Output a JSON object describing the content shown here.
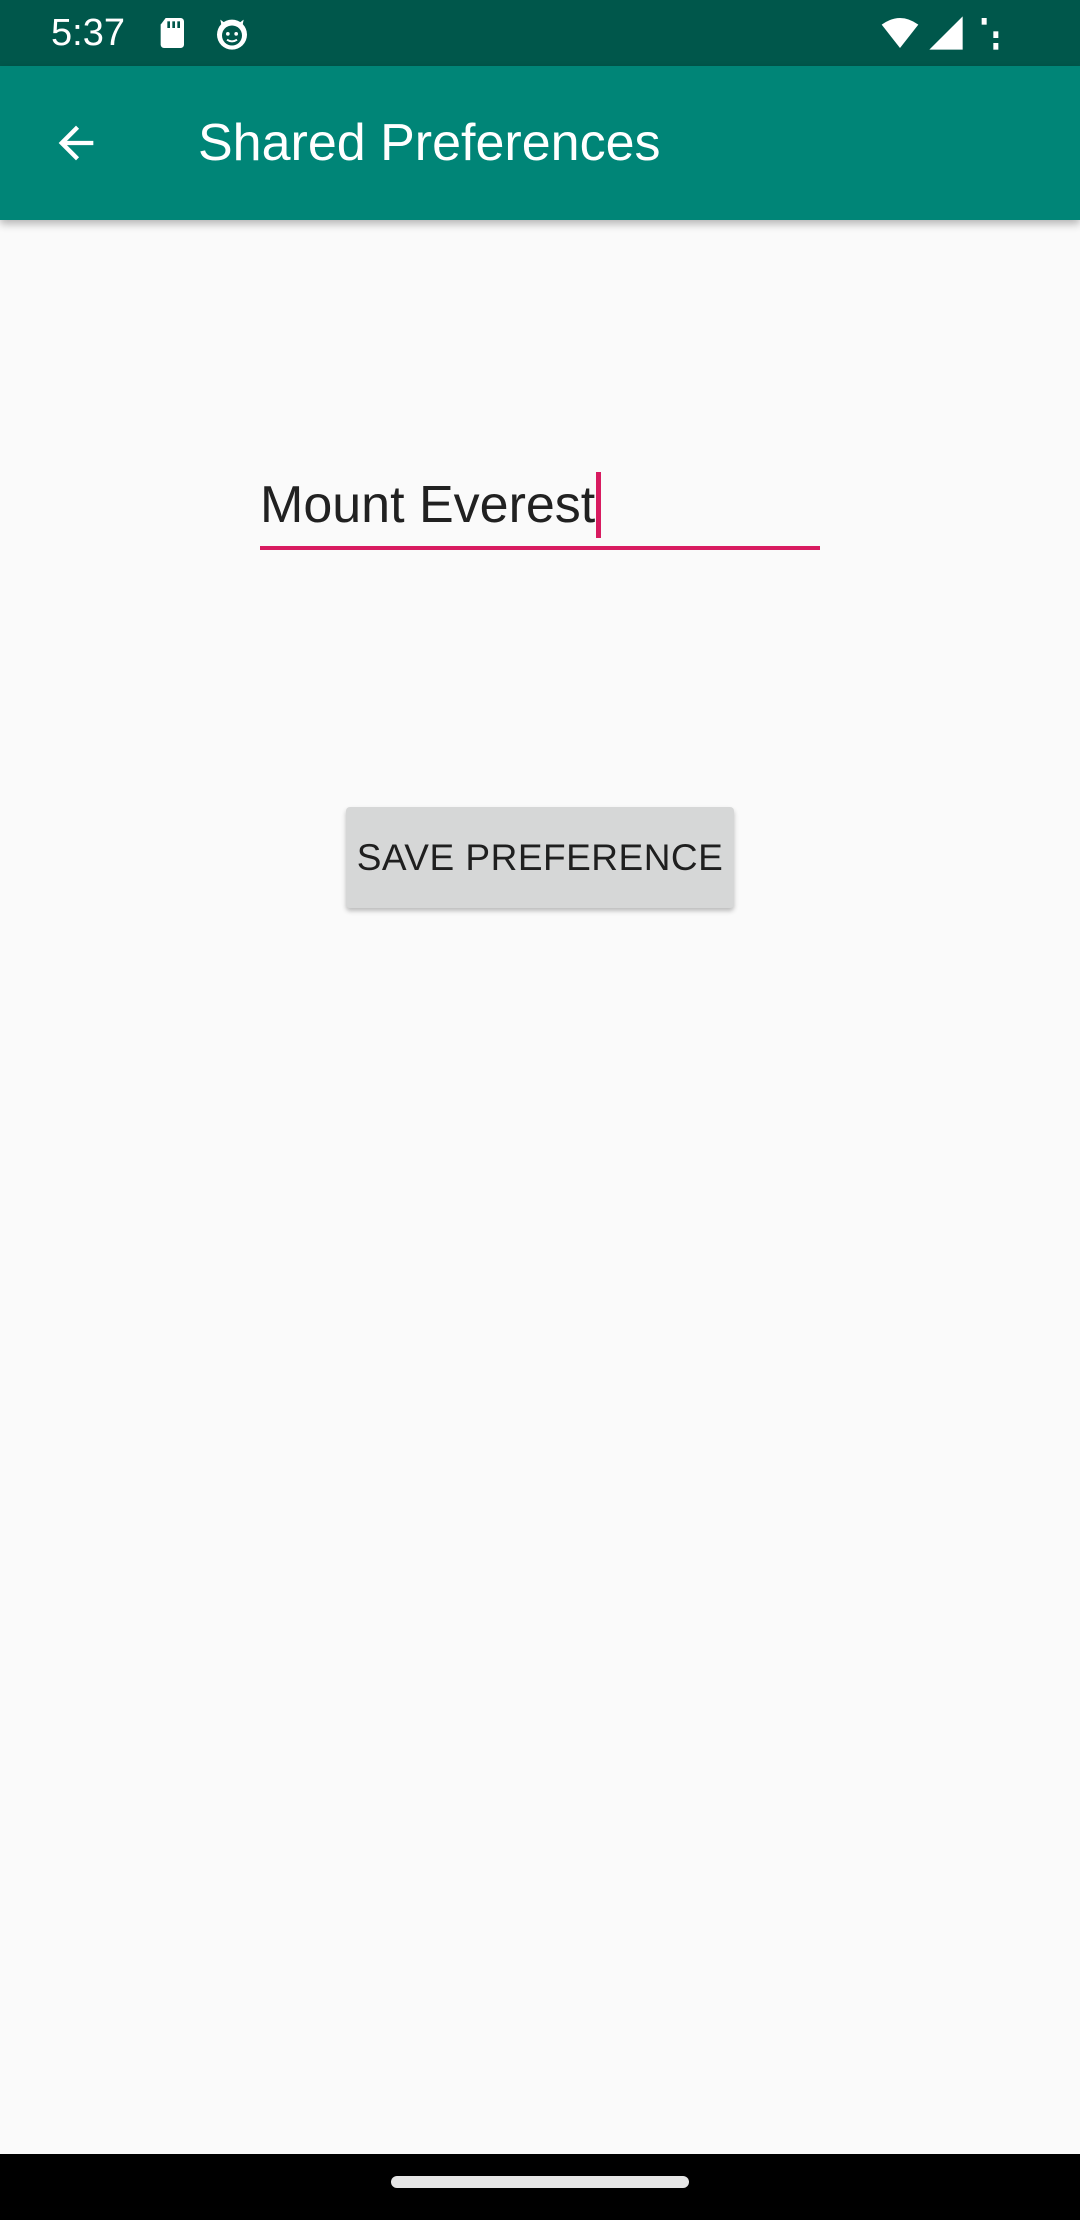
{
  "status_bar": {
    "time": "5:37",
    "icons": [
      "sd-card-icon",
      "cat-face-icon",
      "wifi-icon",
      "signal-icon",
      "more-dots-icon"
    ],
    "background": "#00574b"
  },
  "app_bar": {
    "title": "Shared Preferences",
    "back_icon": "arrow-back-icon",
    "background": "#008577"
  },
  "form": {
    "text_value": "Mount Everest",
    "accent_color": "#d81b60",
    "save_label": "SAVE PREFERENCE"
  },
  "nav_bar": {
    "handle": "home-gesture-handle"
  }
}
